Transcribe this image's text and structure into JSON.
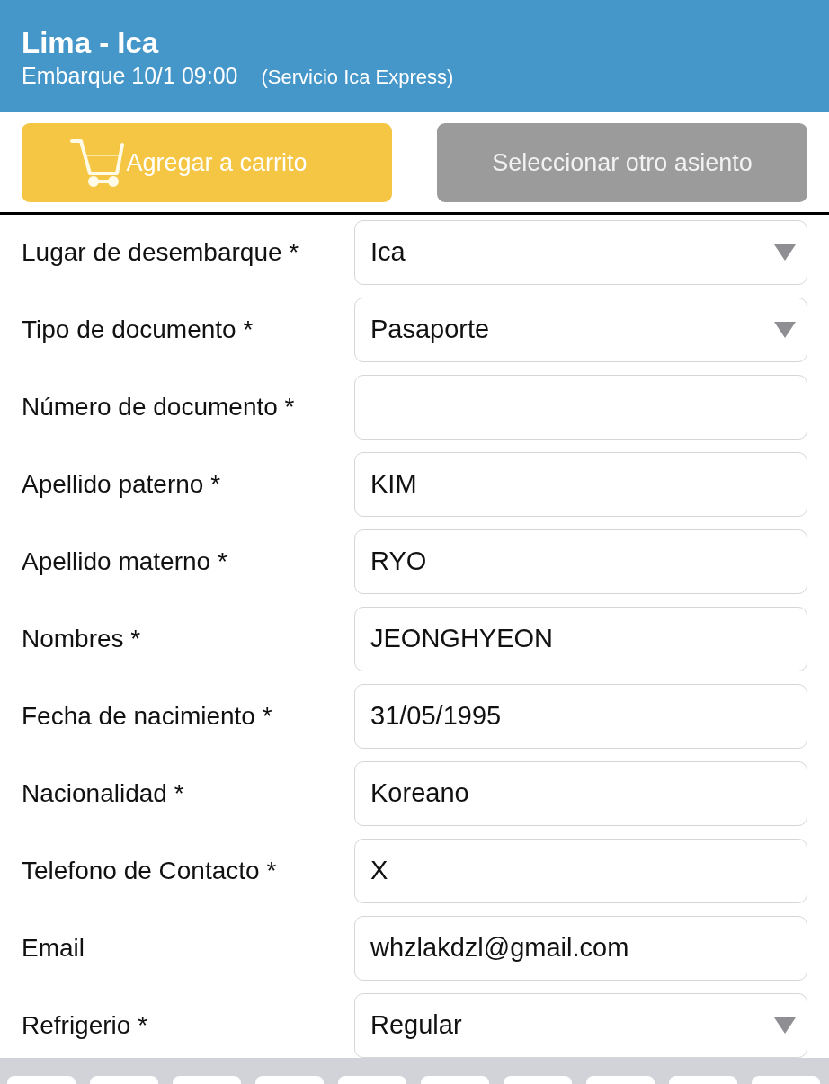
{
  "header": {
    "title": "Lima - Ica",
    "departure": "Embarque 10/1 09:00",
    "service": "(Servicio Ica Express)"
  },
  "actions": [
    {
      "kind": "cart",
      "label": "Agregar a carrito"
    },
    {
      "kind": "secondary",
      "label": "Seleccionar otro asiento"
    }
  ],
  "form": {
    "fields": [
      {
        "label": "Lugar de desembarque *",
        "kind": "select",
        "value": "Ica"
      },
      {
        "label": "Tipo de documento *",
        "kind": "select",
        "value": "Pasaporte"
      },
      {
        "label": "Número de documento *",
        "kind": "text"
      },
      {
        "label": "Apellido paterno *",
        "kind": "text",
        "value": "KIM"
      },
      {
        "label": "Apellido materno *",
        "kind": "text",
        "value": "RYO"
      },
      {
        "label": "Nombres *",
        "kind": "text",
        "value": "JEONGHYEON"
      },
      {
        "label": "Fecha de nacimiento *",
        "kind": "text",
        "value": "31/05/1995"
      },
      {
        "label": "Nacionalidad *",
        "kind": "text",
        "value": "Koreano"
      },
      {
        "label": "Telefono de Contacto *",
        "kind": "text",
        "value": "X"
      },
      {
        "label": "Email",
        "kind": "text",
        "value": "whzlakdzl@gmail.com"
      },
      {
        "label": "Refrigerio *",
        "kind": "select",
        "value": "Regular"
      }
    ]
  }
}
